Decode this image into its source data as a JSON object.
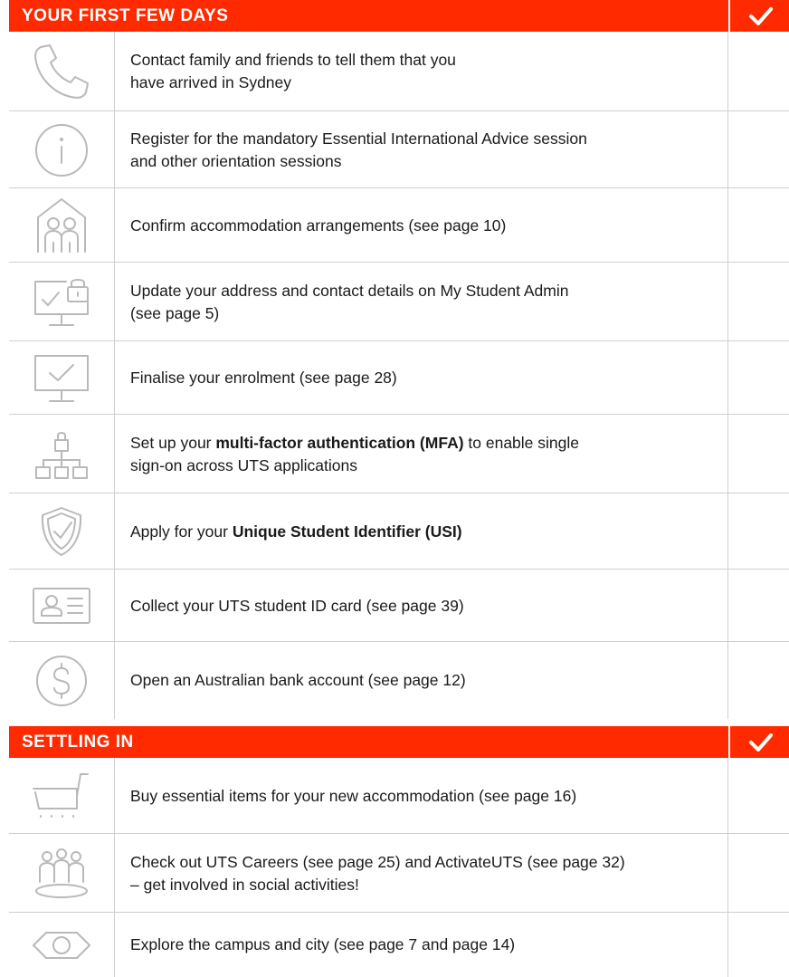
{
  "sections": [
    {
      "title": "YOUR FIRST FEW DAYS",
      "check_icon": "checkmark-icon",
      "items": [
        {
          "icon": "phone-icon",
          "text": "Contact family and friends to tell them that you have arrived in Sydney",
          "line1": "Contact family and friends to tell them that you",
          "line2": "have arrived in Sydney"
        },
        {
          "icon": "info-icon",
          "line1": "Register for the mandatory Essential International Advice session",
          "line2": "and other orientation sessions"
        },
        {
          "icon": "house-people-icon",
          "line1": "Confirm accommodation arrangements (see page 10)"
        },
        {
          "icon": "monitor-lock-icon",
          "line1": "Update your address and contact details on My Student Admin",
          "line2": "(see page 5)"
        },
        {
          "icon": "monitor-check-icon",
          "line1": "Finalise your enrolment (see page 28)"
        },
        {
          "icon": "network-lock-icon",
          "pre": "Set up your ",
          "bold": "multi-factor authentication (MFA)",
          "post": " to enable single",
          "line2": "sign-on across UTS applications"
        },
        {
          "icon": "shield-check-icon",
          "pre": "Apply for your ",
          "bold": "Unique Student Identifier (USI)"
        },
        {
          "icon": "id-card-icon",
          "line1": "Collect your UTS student ID card (see page 39)"
        },
        {
          "icon": "dollar-icon",
          "line1": "Open an Australian bank account (see page 12)"
        }
      ]
    },
    {
      "title": "SETTLING IN",
      "check_icon": "checkmark-icon",
      "items": [
        {
          "icon": "cart-icon",
          "line1": "Buy essential items for your new accommodation (see page 16)"
        },
        {
          "icon": "group-icon",
          "line1": "Check out UTS Careers (see page 25) and ActivateUTS (see page 32)",
          "line2": "– get involved in social activities!"
        },
        {
          "icon": "eye-icon",
          "line1": "Explore the campus and city (see page 7 and page 14)"
        }
      ]
    }
  ]
}
